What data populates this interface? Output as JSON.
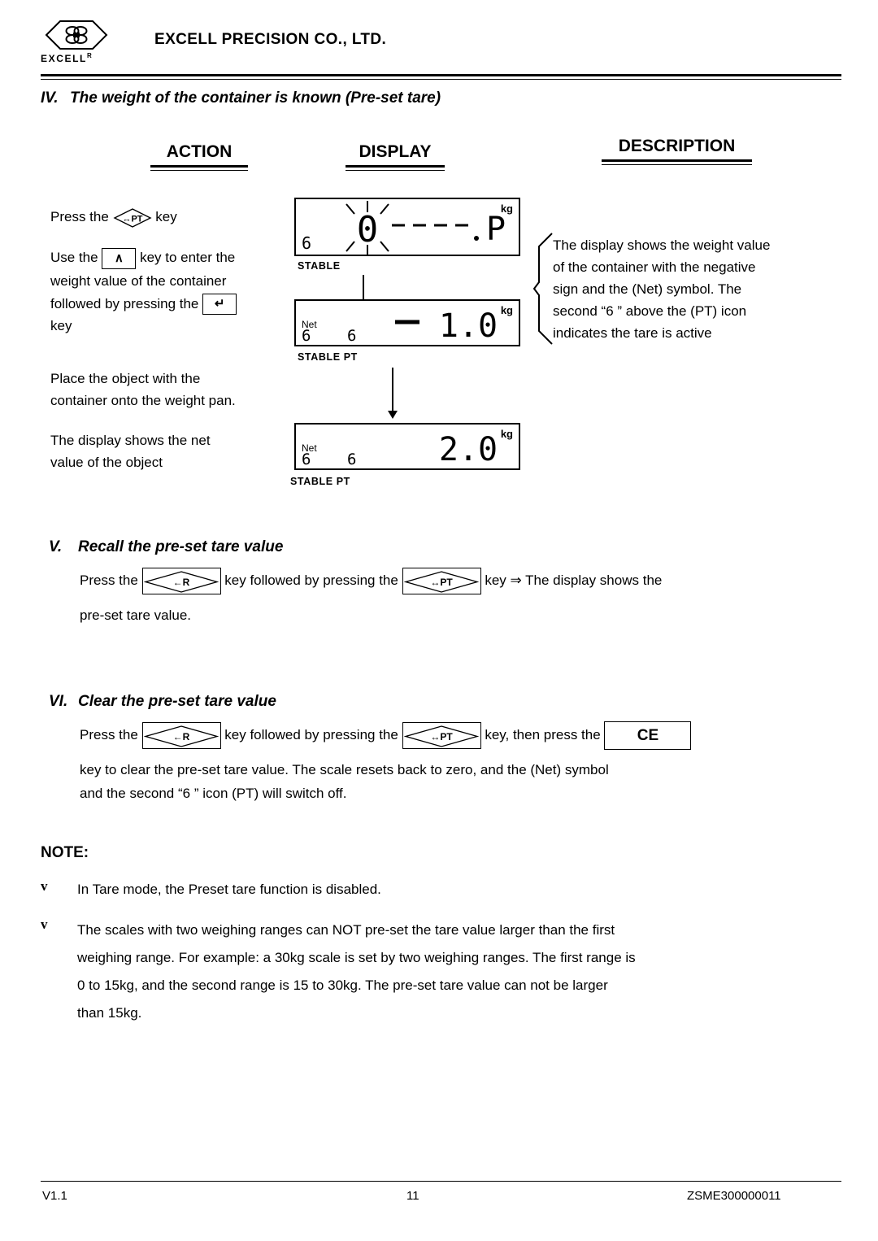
{
  "header": {
    "logo_word": "EXCELL",
    "logo_sup": "R",
    "company": "EXCELL PRECISION CO., LTD."
  },
  "sections": {
    "four": {
      "roman": "IV.",
      "title": "The weight of the container is known (Pre-set tare)"
    },
    "five": {
      "roman": "V.",
      "title": "Recall the pre-set tare value",
      "line1_a": "Press the",
      "line1_b": "key followed by pressing the",
      "line1_c": "key ⇒ The display shows the",
      "line2": "pre-set tare value."
    },
    "six": {
      "roman": "VI.",
      "title": "Clear the pre-set tare value",
      "line1_a": "Press the",
      "line1_b": "key followed by pressing the",
      "line1_c": "key, then press the",
      "line2": "key to clear the pre-set tare value. The scale resets back to zero, and the (Net) symbol",
      "line3": "and the second “6 ” icon (PT) will switch off."
    }
  },
  "columns": {
    "action": "ACTION",
    "display": "DISPLAY",
    "description": "DESCRIPTION"
  },
  "action_steps": {
    "s1_a": "Press the",
    "s1_b": "key",
    "s2_a": "Use the",
    "s2_b": "key to enter the",
    "s2_c": "weight value of the container",
    "s2_d": "followed by pressing the",
    "s2_e": "key",
    "s3_a": "Place the object with the",
    "s3_b": "container onto the weight pan.",
    "s4_a": "The display shows the net",
    "s4_b": "value of the object"
  },
  "description_text": {
    "l1": "The display shows the weight value",
    "l2": "of the container with the negative",
    "l3": "sign and the (Net) symbol. The",
    "l4": "second “6 ” above the (PT) icon",
    "l5": "indicates the tare is active"
  },
  "keys": {
    "pt": "PT",
    "pt_prefix": "↔",
    "up_arrow": "∧",
    "enter": "↵",
    "r": "R",
    "r_prefix": "←",
    "ce": "CE"
  },
  "lcd": {
    "panel1": {
      "value": "0- - - -.P",
      "unit": "kg",
      "flags": "STABLE",
      "net": "",
      "sub": "6",
      "blink": true
    },
    "panel2": {
      "value": "1.0",
      "unit": "kg",
      "flags": "STABLE  PT",
      "net": "Net",
      "minus": "—",
      "sub_left": "6",
      "sub_right": "6"
    },
    "panel3": {
      "value": "2.0",
      "unit": "kg",
      "flags": "STABLE  PT",
      "net": "Net",
      "sub_left": "6",
      "sub_right": "6"
    }
  },
  "note": {
    "title": "NOTE:",
    "bullet": "v",
    "items": [
      "In Tare mode, the Preset tare function is disabled.",
      "The scales with two weighing ranges can NOT pre-set the tare value larger than the first weighing range. For example: a 30kg scale is set by two weighing ranges. The first range is 0 to 15kg, and the second range is 15 to 30kg. The pre-set tare value can not be larger than 15kg."
    ],
    "item2_lines": [
      "The scales with two weighing ranges can NOT pre-set the tare value larger than the first",
      "weighing range. For example: a 30kg scale is set by two weighing ranges. The first range is",
      "0 to 15kg, and the second range is 15 to 30kg. The pre-set tare value can not be larger",
      "than 15kg."
    ]
  },
  "footer": {
    "version": "V1.1",
    "page": "11",
    "doc_id": "ZSME300000011"
  }
}
